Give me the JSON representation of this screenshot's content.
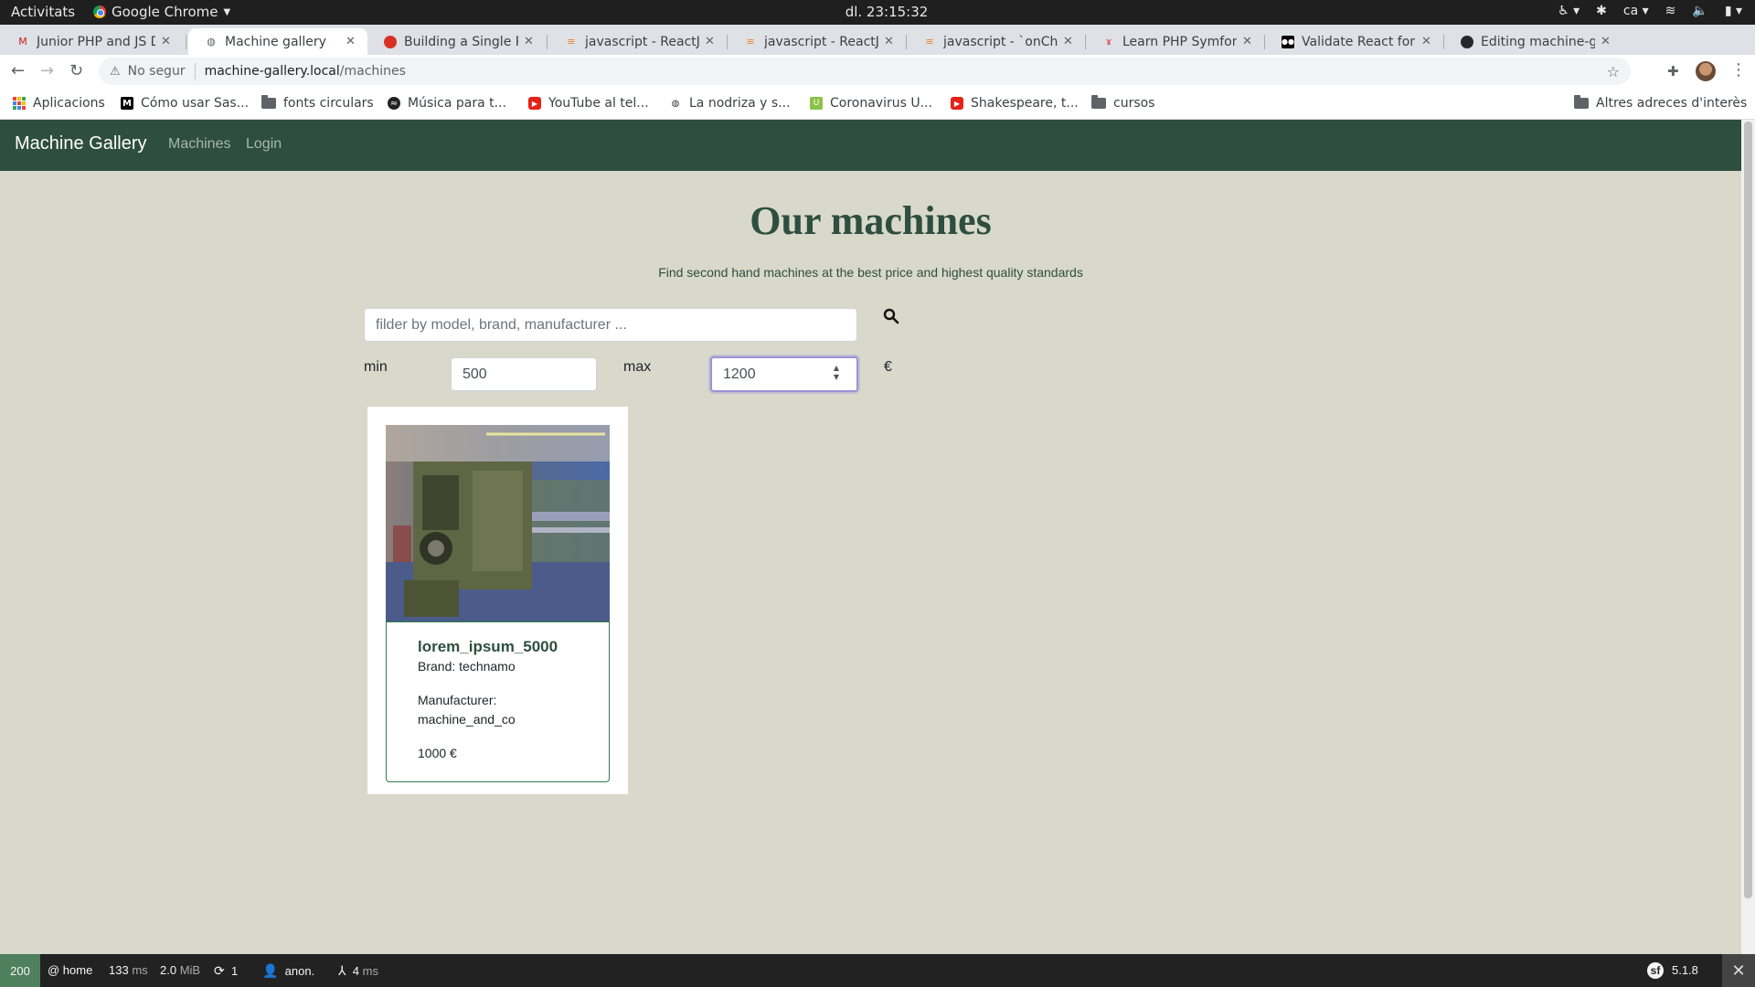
{
  "os_bar": {
    "activities": "Activitats",
    "app_name": "Google Chrome",
    "clock": "dl. 23:15:32",
    "lang": "ca"
  },
  "tabs": [
    {
      "label": "Junior PHP and JS D",
      "fav_color": "#c5221f",
      "active": false
    },
    {
      "label": "Machine gallery",
      "fav_color": "#5f6368",
      "active": true
    },
    {
      "label": "Building a Single Pa",
      "fav_color": "#d93025",
      "active": false
    },
    {
      "label": "javascript - ReactJS",
      "fav_color": "#f48024",
      "active": false
    },
    {
      "label": "javascript - ReactJS",
      "fav_color": "#f48024",
      "active": false
    },
    {
      "label": "javascript - `onChar",
      "fav_color": "#f48024",
      "active": false
    },
    {
      "label": "Learn PHP Symfony",
      "fav_color": "#d93025",
      "active": false
    },
    {
      "label": "Validate React form",
      "fav_color": "#000000",
      "active": false
    },
    {
      "label": "Editing machine-ga",
      "fav_color": "#24292e",
      "active": false
    }
  ],
  "omnibox": {
    "security": "No segur",
    "host": "machine-gallery.local",
    "path": "/machines"
  },
  "bookmarks": [
    {
      "label": "Aplicacions",
      "icon": "apps-grid-icon"
    },
    {
      "label": "Cómo usar Sas...",
      "icon": "medium-icon"
    },
    {
      "label": "fonts circulars",
      "icon": "folder-icon"
    },
    {
      "label": "Música para t...",
      "icon": "spotify-icon"
    },
    {
      "label": "YouTube al tel...",
      "icon": "youtube-icon"
    },
    {
      "label": "La nodriza y s...",
      "icon": "globe-icon"
    },
    {
      "label": "Coronavirus U...",
      "icon": "site-icon"
    },
    {
      "label": "Shakespeare, t...",
      "icon": "youtube-icon"
    },
    {
      "label": "cursos",
      "icon": "folder-icon"
    }
  ],
  "bookmarks_other": "Altres adreces d'interès",
  "site": {
    "brand": "Machine Gallery",
    "nav": [
      "Machines",
      "Login"
    ],
    "heading": "Our machines",
    "subheading": "Find second hand machines at the best price and highest quality standards",
    "search_placeholder": "filder by model, brand, manufacturer ...",
    "min_label": "min",
    "max_label": "max",
    "min_value": "500",
    "max_value": "1200",
    "currency": "€"
  },
  "machines": [
    {
      "name": "lorem_ipsum_5000",
      "brand": "Brand: technamo",
      "manufacturer_label": "Manufacturer:",
      "manufacturer": "machine_and_co",
      "price": "1000 €"
    }
  ],
  "sf_toolbar": {
    "status": "200",
    "route": "@ home",
    "time": "133",
    "time_unit": "ms",
    "memory": "2.0",
    "memory_unit": "MiB",
    "requests": "1",
    "user": "anon.",
    "twig": "4",
    "twig_unit": "ms",
    "version": "5.1.8"
  },
  "colors": {
    "nav_bg": "#2e4e3f",
    "page_bg": "#d8d9cb",
    "accent_green": "#2e4e3f",
    "focus_ring": "#9b93d8"
  }
}
